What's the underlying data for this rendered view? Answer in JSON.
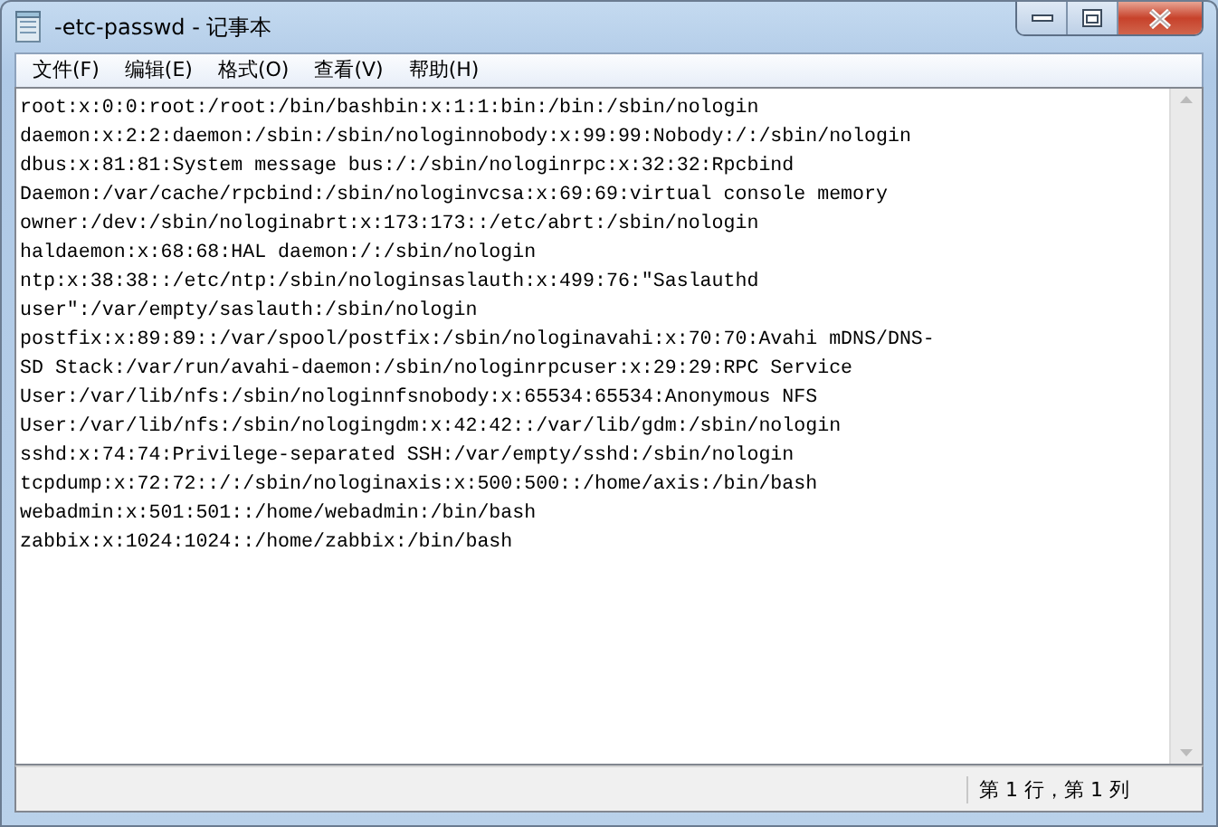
{
  "window": {
    "title": "-etc-passwd - 记事本"
  },
  "menu": [
    "文件(F)",
    "编辑(E)",
    "格式(O)",
    "查看(V)",
    "帮助(H)"
  ],
  "editor": {
    "lines": [
      "root:x:0:0:root:/root:/bin/bashbin:x:1:1:bin:/bin:/sbin/nologin",
      "daemon:x:2:2:daemon:/sbin:/sbin/nologinnobody:x:99:99:Nobody:/:/sbin/nologin",
      "dbus:x:81:81:System message bus:/:/sbin/nologinrpc:x:32:32:Rpcbind",
      "Daemon:/var/cache/rpcbind:/sbin/nologinvcsa:x:69:69:virtual console memory",
      "owner:/dev:/sbin/nologinabrt:x:173:173::/etc/abrt:/sbin/nologin",
      "haldaemon:x:68:68:HAL daemon:/:/sbin/nologin",
      "ntp:x:38:38::/etc/ntp:/sbin/nologinsaslauth:x:499:76:\"Saslauthd",
      "user\":/var/empty/saslauth:/sbin/nologin",
      "postfix:x:89:89::/var/spool/postfix:/sbin/nologinavahi:x:70:70:Avahi mDNS/DNS-",
      "SD Stack:/var/run/avahi-daemon:/sbin/nologinrpcuser:x:29:29:RPC Service",
      "User:/var/lib/nfs:/sbin/nologinnfsnobody:x:65534:65534:Anonymous NFS",
      "User:/var/lib/nfs:/sbin/nologingdm:x:42:42::/var/lib/gdm:/sbin/nologin",
      "sshd:x:74:74:Privilege-separated SSH:/var/empty/sshd:/sbin/nologin",
      "tcpdump:x:72:72::/:/sbin/nologinaxis:x:500:500::/home/axis:/bin/bash",
      "webadmin:x:501:501::/home/webadmin:/bin/bash",
      "zabbix:x:1024:1024::/home/zabbix:/bin/bash"
    ]
  },
  "status_bar": {
    "position": "第 1 行，第 1 列"
  }
}
